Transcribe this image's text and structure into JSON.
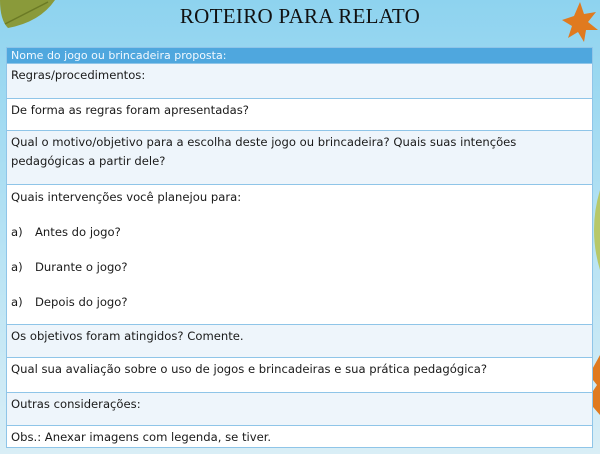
{
  "title": "ROTEIRO PARA RELATO",
  "header": "Nome do jogo ou brincadeira proposta:",
  "rows": {
    "regras": "Regras/procedimentos:",
    "forma": "De forma as regras foram apresentadas?",
    "motivo": "Qual o motivo/objetivo para a escolha deste jogo ou brincadeira? Quais suas intenções pedagógicas a partir dele?",
    "intervencoes": "Quais intervenções você planejou para:",
    "sub": [
      {
        "letter": "a)",
        "text": "Antes do jogo?"
      },
      {
        "letter": "a)",
        "text": "Durante o jogo?"
      },
      {
        "letter": "a)",
        "text": "Depois do jogo?"
      }
    ],
    "objetivos": "Os objetivos foram atingidos? Comente.",
    "avaliacao": "Qual sua avaliação sobre o uso de jogos e brincadeiras e sua prática pedagógica?",
    "outras": "Outras considerações:",
    "obs": "Obs.: Anexar imagens com legenda, se tiver."
  },
  "colors": {
    "header": "#4fa7de",
    "border": "#8fc5e8",
    "tint": "#eef5fb"
  }
}
